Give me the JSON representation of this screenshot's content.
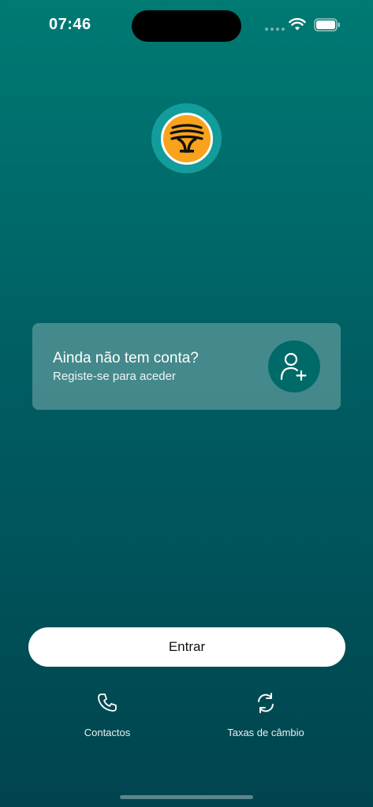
{
  "status_bar": {
    "time": "07:46"
  },
  "register_card": {
    "title": "Ainda não tem conta?",
    "subtitle": "Registe-se para aceder",
    "icon": "add-user-icon"
  },
  "login_button": {
    "label": "Entrar"
  },
  "bottom_actions": [
    {
      "label": "Contactos",
      "icon": "phone-icon"
    },
    {
      "label": "Taxas de câmbio",
      "icon": "refresh-icon"
    }
  ],
  "colors": {
    "background_top": "#007a73",
    "background_bottom": "#00444e",
    "logo_ring": "#139c9c",
    "logo_fill": "#f9a21b",
    "card_icon_bg": "#006a69"
  }
}
